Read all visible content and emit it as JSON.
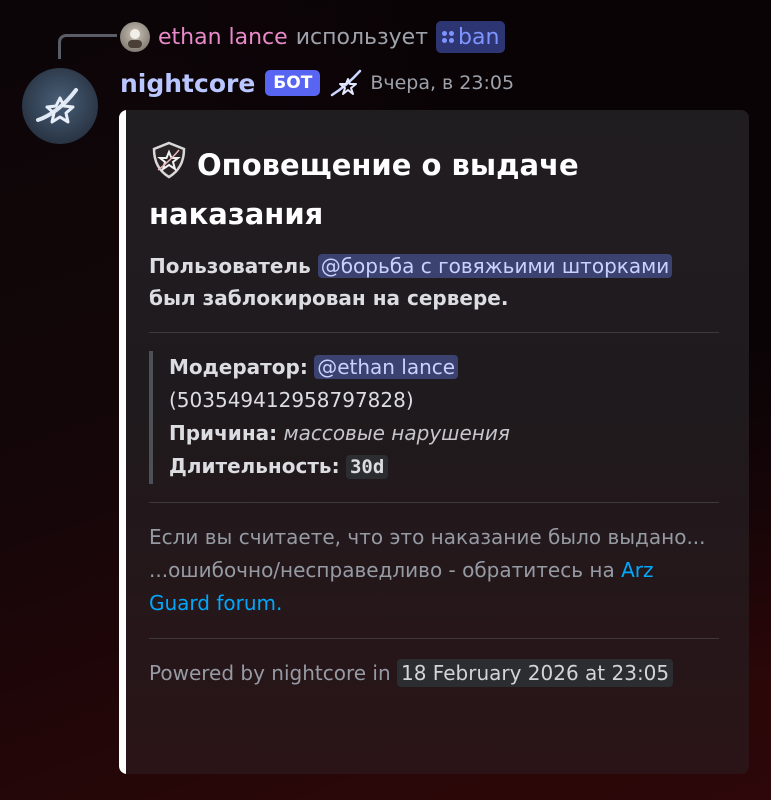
{
  "reply": {
    "user_name": "ethan lance",
    "action_text": "использует",
    "command": "ban"
  },
  "message": {
    "author": "nightcore",
    "bot_tag": "БОТ",
    "timestamp": "Вчера, в 23:05"
  },
  "embed": {
    "title": "Оповещение о выдаче наказания",
    "desc_prefix": "Пользователь",
    "desc_mention": "@борьба с говяжьими шторками",
    "desc_suffix": "был заблокирован на сервере.",
    "moderator_label": "Модератор:",
    "moderator_mention": "@ethan lance",
    "moderator_id": "(503549412958797828)",
    "reason_label": "Причина:",
    "reason_value": "массовые нарушения",
    "duration_label": "Длительность:",
    "duration_value": "30d",
    "note_line1": "Если вы считаете, что это наказание было выдано...",
    "note_line2_prefix": "...ошибочно/несправедливо - обратитесь на",
    "note_link": "Arz Guard forum",
    "note_suffix": ".",
    "footer_text": "Powered by nightcore in",
    "footer_timestamp": "18 February 2026 at 23:05",
    "accent_color": "#ffffff"
  },
  "colors": {
    "mention_bg": "#3c4270",
    "link": "#00a8fc",
    "bot_tag": "#5865f2",
    "reply_name": "#e889c9"
  }
}
